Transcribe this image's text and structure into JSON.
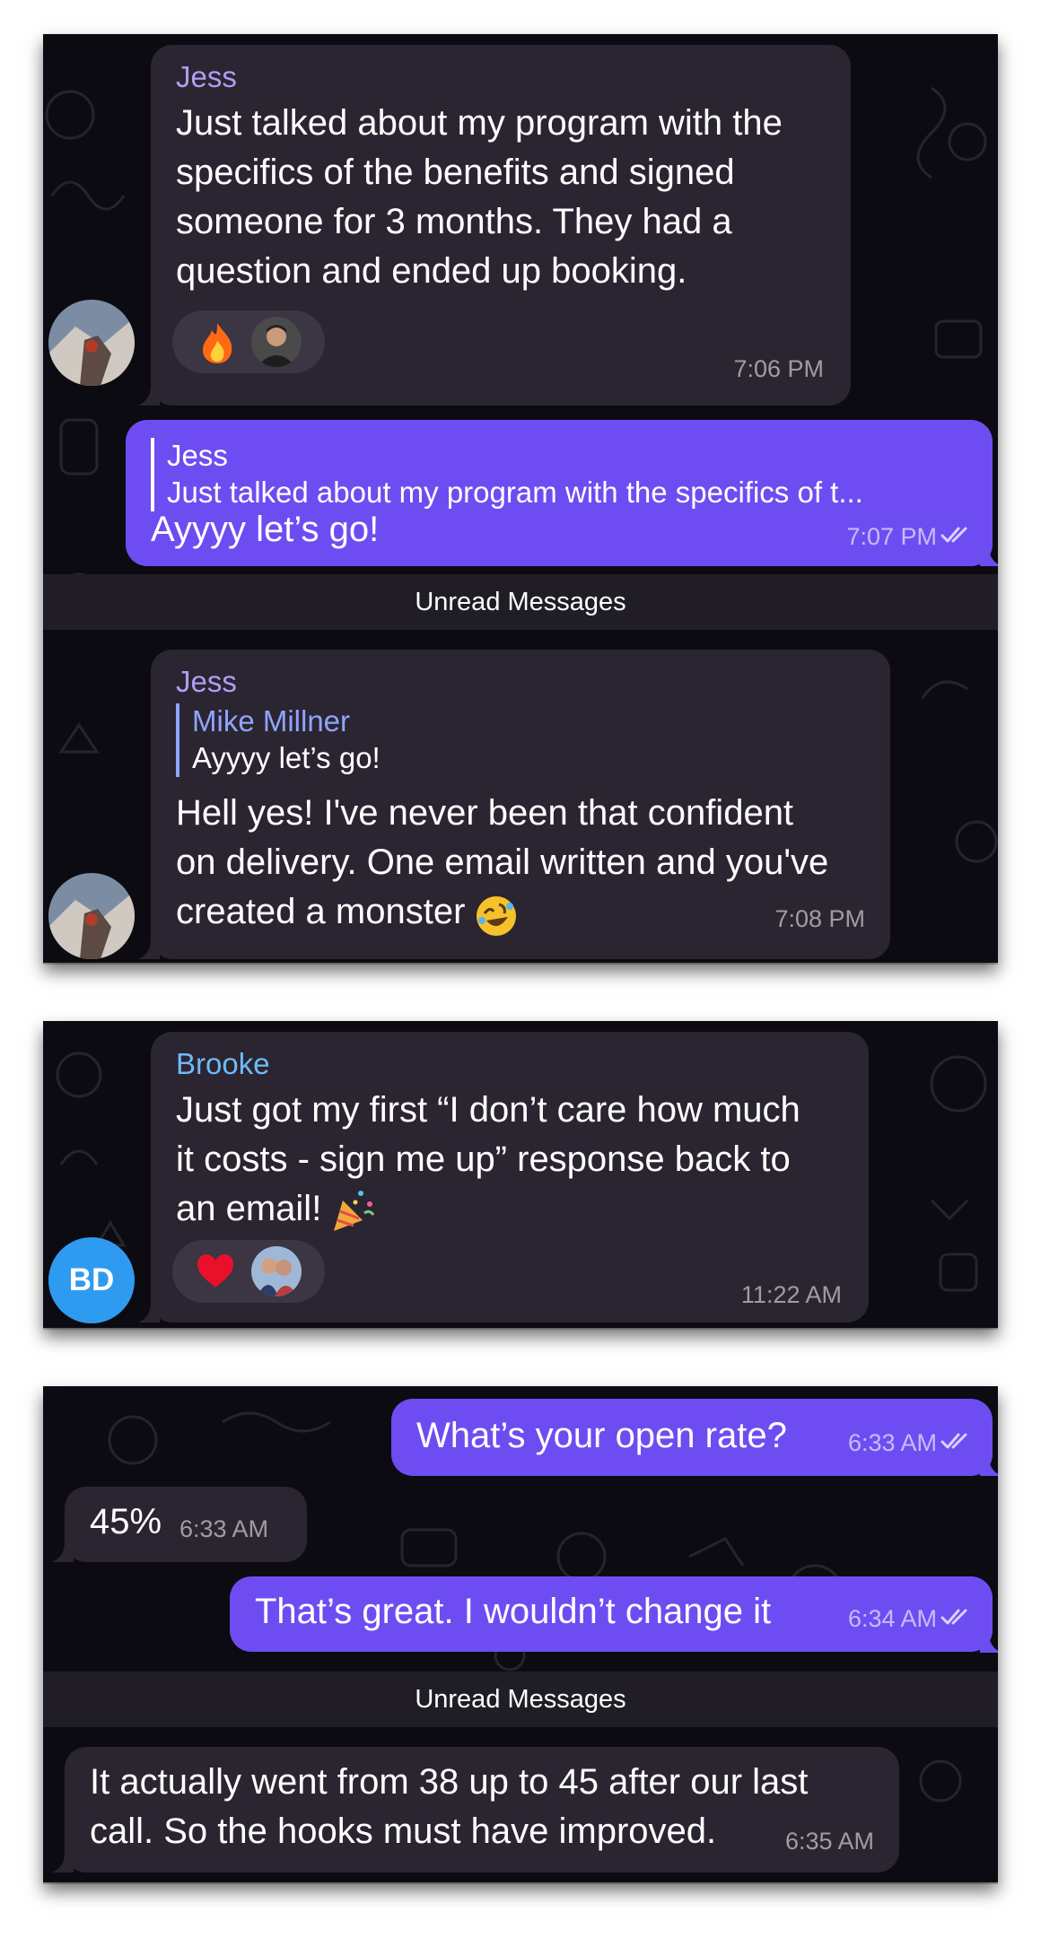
{
  "colors": {
    "panel_bg": "#0c0b12",
    "incoming_bubble": "#2a2531",
    "outgoing_bubble": "#6d4df2",
    "sender_jess": "#b29cf5",
    "sender_brooke": "#6fbaf6",
    "reply_name_mike": "#8fa4ff",
    "initials_avatar": "#2f9bf0",
    "unread_bar": "#211d26"
  },
  "chat1": {
    "msg1": {
      "sender": "Jess",
      "lines": [
        "Just talked about my program with the",
        "specifics of the benefits and signed",
        "someone for 3 months. They had a",
        "question and ended up booking."
      ],
      "reaction_icon": "fire-emoji",
      "time": "7:06 PM"
    },
    "msg2": {
      "reply_name": "Jess",
      "reply_text": "Just talked about my program with the specifics of t...",
      "text": "Ayyyy let’s go!",
      "time": "7:07 PM"
    },
    "unread_label": "Unread Messages",
    "msg3": {
      "sender": "Jess",
      "reply_name": "Mike Millner",
      "reply_text": "Ayyyy let’s go!",
      "lines": [
        "Hell yes! I've never been that confident",
        "on delivery. One email written and you've",
        "created a monster"
      ],
      "emoji_icon": "rolling-laughing-emoji",
      "time": "7:08 PM"
    }
  },
  "chat2": {
    "sender": "Brooke",
    "lines": [
      "Just got my first “I don’t care how much",
      "it costs - sign me up” response back to",
      "an email!"
    ],
    "emoji_icon": "party-popper-emoji",
    "reaction_icon": "red-heart-emoji",
    "avatar_initials": "BD",
    "time": "11:22 AM"
  },
  "chat3": {
    "msg1": {
      "text": "What’s your open rate?",
      "time": "6:33 AM"
    },
    "msg2": {
      "text": "45%",
      "time": "6:33 AM"
    },
    "msg3": {
      "text": "That’s great. I wouldn’t change it",
      "time": "6:34 AM"
    },
    "unread_label": "Unread Messages",
    "msg4": {
      "lines": [
        "It actually went from 38 up to 45 after our last",
        "call. So the hooks must have improved."
      ],
      "time": "6:35 AM"
    }
  }
}
